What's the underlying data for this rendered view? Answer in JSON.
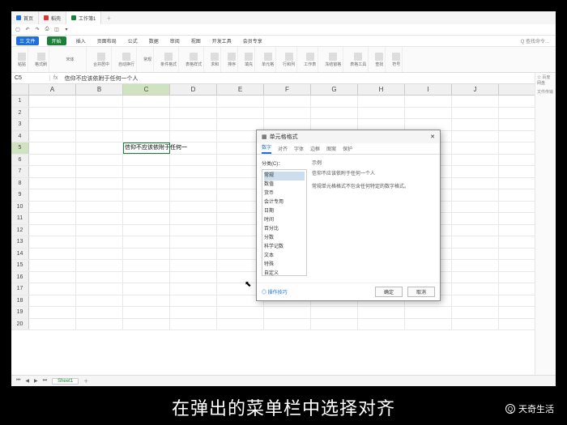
{
  "tabs": {
    "t1": "首页",
    "t2": "稻壳",
    "t3": "工作簿1"
  },
  "menu": {
    "file": "三 文件",
    "start": "开始",
    "insert": "插入",
    "layout": "页面布局",
    "formula": "公式",
    "data": "数据",
    "review": "审阅",
    "view": "视图",
    "dev": "开发工具",
    "member": "会员专享",
    "search": "Q 查找命令..."
  },
  "ribbon": {
    "g1": "格式刷",
    "g2": "粘贴",
    "font": "宋体",
    "g3": "合并居中",
    "g4": "自动换行",
    "g5": "常规",
    "g6": "条件格式",
    "g7": "表格样式",
    "g8": "求和",
    "g9": "排序",
    "g10": "填充",
    "g11": "单元格",
    "g12": "行和列",
    "g13": "工作表",
    "g14": "冻结窗格",
    "g15": "表格工具",
    "g16": "查找",
    "g17": "符号"
  },
  "namebox": "C5",
  "formula": "信仰不应该依附于任何一个人",
  "cols": [
    "A",
    "B",
    "C",
    "D",
    "E",
    "F",
    "G",
    "H",
    "I",
    "J"
  ],
  "rows": [
    "1",
    "2",
    "3",
    "4",
    "5",
    "6",
    "7",
    "8",
    "9",
    "10",
    "11",
    "12",
    "13",
    "14",
    "15",
    "16",
    "17",
    "18",
    "19",
    "20"
  ],
  "cell_c5": "信仰不应该依附于任何一",
  "sheet": "Sheet1",
  "side": {
    "t1": "☆ 百度网盘",
    "t2": "文件传输"
  },
  "dialog": {
    "title": "单元格格式",
    "tabs": {
      "number": "数字",
      "align": "对齐",
      "font": "字体",
      "border": "边框",
      "pattern": "图案",
      "protect": "保护"
    },
    "cat_title": "分类(C)：",
    "cats": [
      "常规",
      "数值",
      "货币",
      "会计专用",
      "日期",
      "时间",
      "百分比",
      "分数",
      "科学记数",
      "文本",
      "特殊",
      "自定义"
    ],
    "sample_label": "示例",
    "sample_value": "信仰不应该依附于任何一个人",
    "desc": "常规单元格格式不包含任何特定的数字格式。",
    "hint": "◎ 操作技巧",
    "ok": "确定",
    "cancel": "取消"
  },
  "caption": "在弹出的菜单栏中选择对齐",
  "watermark": "天奇生活"
}
